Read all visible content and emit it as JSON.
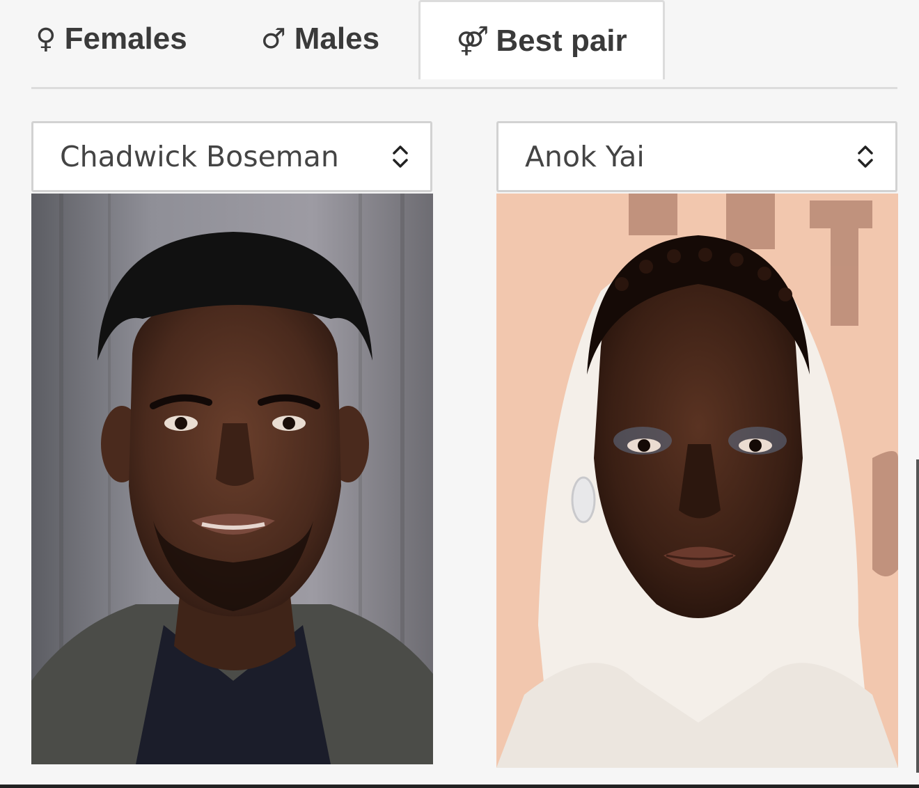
{
  "tabs": [
    {
      "id": "females",
      "symbol": "♀",
      "label": "Females"
    },
    {
      "id": "males",
      "symbol": "♂",
      "label": "Males"
    },
    {
      "id": "best",
      "symbol": "⚤",
      "label": "Best pair"
    }
  ],
  "active_tab": "best",
  "selects": {
    "left": {
      "value": "Chadwick Boseman"
    },
    "right": {
      "value": "Anok Yai"
    }
  },
  "colors": {
    "tab_text": "#3a3a3a",
    "border": "#dcdcdc",
    "page_bg": "#f6f6f6"
  }
}
